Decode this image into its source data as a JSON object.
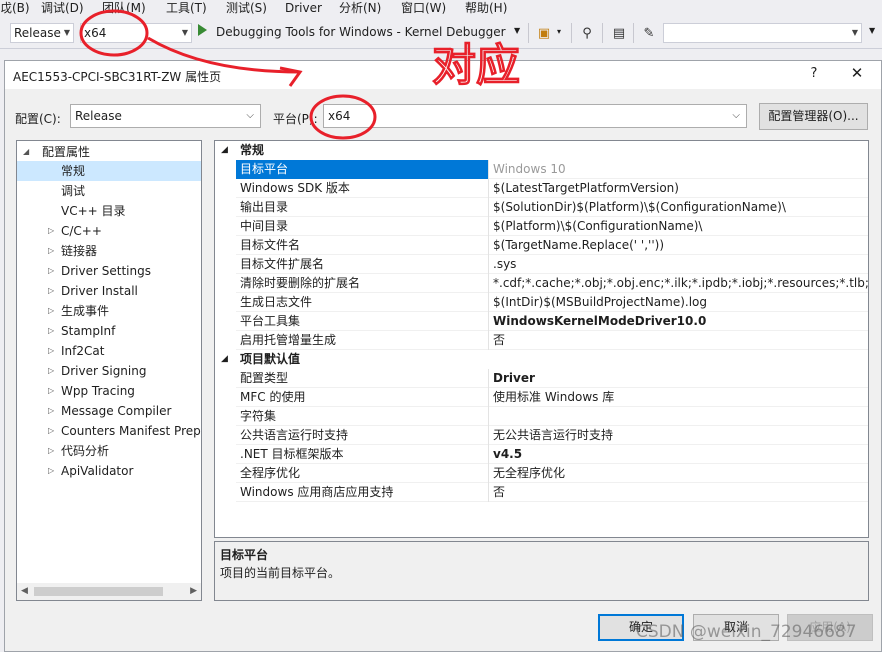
{
  "menubar": {
    "items": [
      "戉(B)",
      "调试(D)",
      "团队(M)",
      "工具(T)",
      "测试(S)",
      "Driver",
      "分析(N)",
      "窗口(W)",
      "帮助(H)"
    ]
  },
  "toolbar": {
    "config_value": "Release",
    "platform_value": "x64",
    "debugger_label": "Debugging Tools for Windows - Kernel Debugger",
    "search_value": ""
  },
  "dialog": {
    "title": "AEC1553-CPCI-SBC31RT-ZW 属性页",
    "help_glyph": "?",
    "close_glyph": "✕",
    "config_label": "配置(C):",
    "config_value": "Release",
    "platform_label": "平台(P):",
    "platform_value": "x64",
    "config_manager_label": "配置管理器(O)..."
  },
  "tree": {
    "root": "配置属性",
    "items": [
      "常规",
      "调试",
      "VC++ 目录",
      "C/C++",
      "链接器",
      "Driver Settings",
      "Driver Install",
      "生成事件",
      "StampInf",
      "Inf2Cat",
      "Driver Signing",
      "Wpp Tracing",
      "Message Compiler",
      "Counters Manifest Preprocessor",
      "代码分析",
      "ApiValidator"
    ],
    "selected": "常规"
  },
  "grid": {
    "categories": [
      {
        "label": "常规",
        "rows": [
          {
            "name": "目标平台",
            "value": "Windows 10"
          },
          {
            "name": "Windows SDK 版本",
            "value": "$(LatestTargetPlatformVersion)"
          },
          {
            "name": "输出目录",
            "value": "$(SolutionDir)$(Platform)\\$(ConfigurationName)\\"
          },
          {
            "name": "中间目录",
            "value": "$(Platform)\\$(ConfigurationName)\\"
          },
          {
            "name": "目标文件名",
            "value": "$(TargetName.Replace(' ',''))"
          },
          {
            "name": "目标文件扩展名",
            "value": ".sys"
          },
          {
            "name": "清除时要删除的扩展名",
            "value": "*.cdf;*.cache;*.obj;*.obj.enc;*.ilk;*.ipdb;*.iobj;*.resources;*.tlb;*.tli;*.t"
          },
          {
            "name": "生成日志文件",
            "value": "$(IntDir)$(MSBuildProjectName).log"
          },
          {
            "name": "平台工具集",
            "value": "WindowsKernelModeDriver10.0"
          },
          {
            "name": "启用托管增量生成",
            "value": "否"
          }
        ]
      },
      {
        "label": "项目默认值",
        "rows": [
          {
            "name": "配置类型",
            "value": "Driver"
          },
          {
            "name": "MFC 的使用",
            "value": "使用标准 Windows 库"
          },
          {
            "name": "字符集",
            "value": ""
          },
          {
            "name": "公共语言运行时支持",
            "value": "无公共语言运行时支持"
          },
          {
            "name": ".NET 目标框架版本",
            "value": "v4.5"
          },
          {
            "name": "全程序优化",
            "value": "无全程序优化"
          },
          {
            "name": "Windows 应用商店应用支持",
            "value": "否"
          }
        ]
      }
    ]
  },
  "description": {
    "title": "目标平台",
    "text": "项目的当前目标平台。"
  },
  "buttons": {
    "ok": "确定",
    "cancel": "取消",
    "apply": "应用(A)"
  },
  "annotation": {
    "handwritten_text": "对应",
    "color": "#e8202a"
  },
  "watermark": "CSDN @weixin_72946687"
}
